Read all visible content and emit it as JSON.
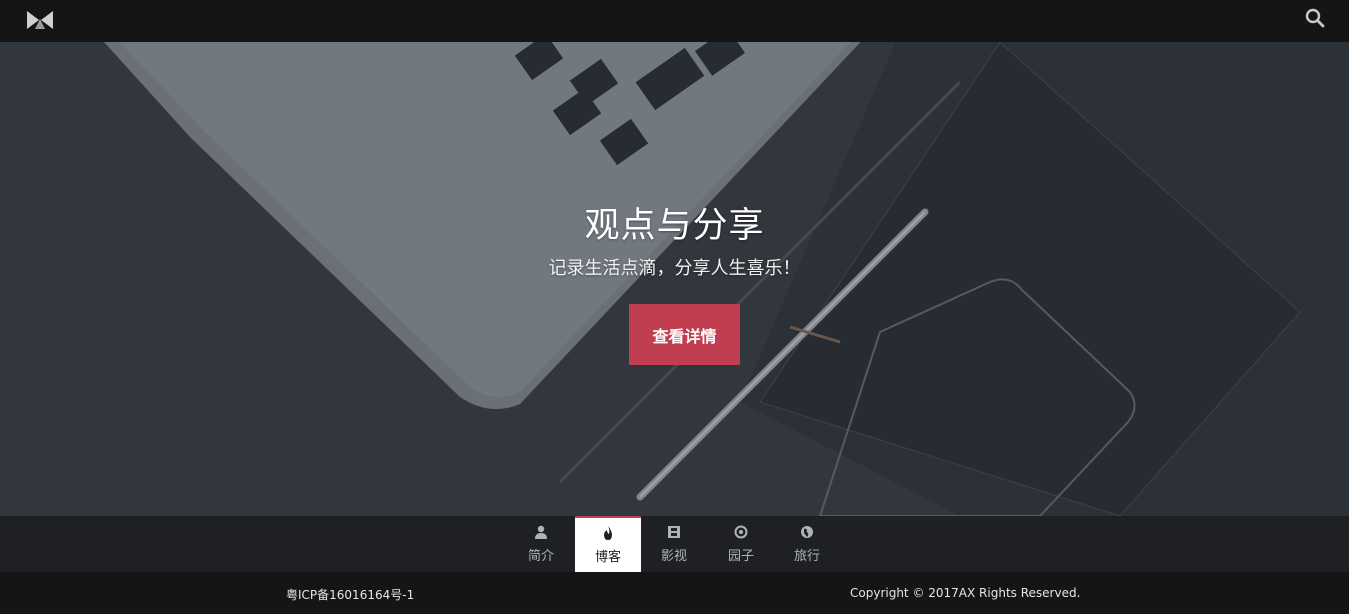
{
  "header": {
    "logo_icon": "bowtie-logo",
    "search_icon": "search-icon"
  },
  "hero": {
    "title": "观点与分享",
    "subtitle": "记录生活点滴，分享人生喜乐！",
    "cta_label": "查看详情"
  },
  "nav": {
    "items": [
      {
        "label": "简介",
        "icon": "user-icon",
        "active": false
      },
      {
        "label": "博客",
        "icon": "flame-icon",
        "active": true
      },
      {
        "label": "影视",
        "icon": "film-icon",
        "active": false
      },
      {
        "label": "园子",
        "icon": "target-icon",
        "active": false
      },
      {
        "label": "旅行",
        "icon": "globe-icon",
        "active": false
      }
    ]
  },
  "footer": {
    "icp": "粤ICP备16016164号-1",
    "copyright": "Copyright © 2017AX Rights Reserved."
  },
  "colors": {
    "accent": "#c13e51",
    "topbar": "#151518",
    "navbar": "#1e2024",
    "hero_bg": "#3d4148"
  }
}
